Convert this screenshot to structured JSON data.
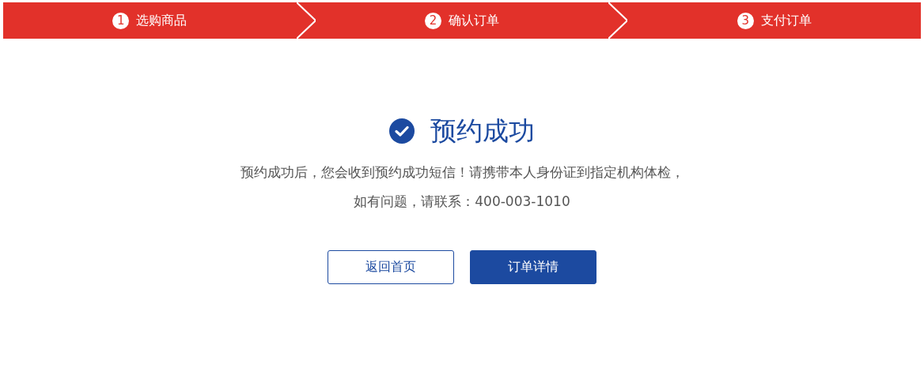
{
  "steps": [
    {
      "number": "1",
      "label": "选购商品"
    },
    {
      "number": "2",
      "label": "确认订单"
    },
    {
      "number": "3",
      "label": "支付订单"
    }
  ],
  "result": {
    "title": "预约成功",
    "message_lines": [
      "预约成功后，您会收到预约成功短信！请携带本人身份证到指定机构体检，",
      "如有问题，请联系：400-003-1010"
    ]
  },
  "buttons": [
    {
      "label": "返回首页",
      "kind": "outline"
    },
    {
      "label": "订单详情",
      "kind": "filled"
    }
  ]
}
